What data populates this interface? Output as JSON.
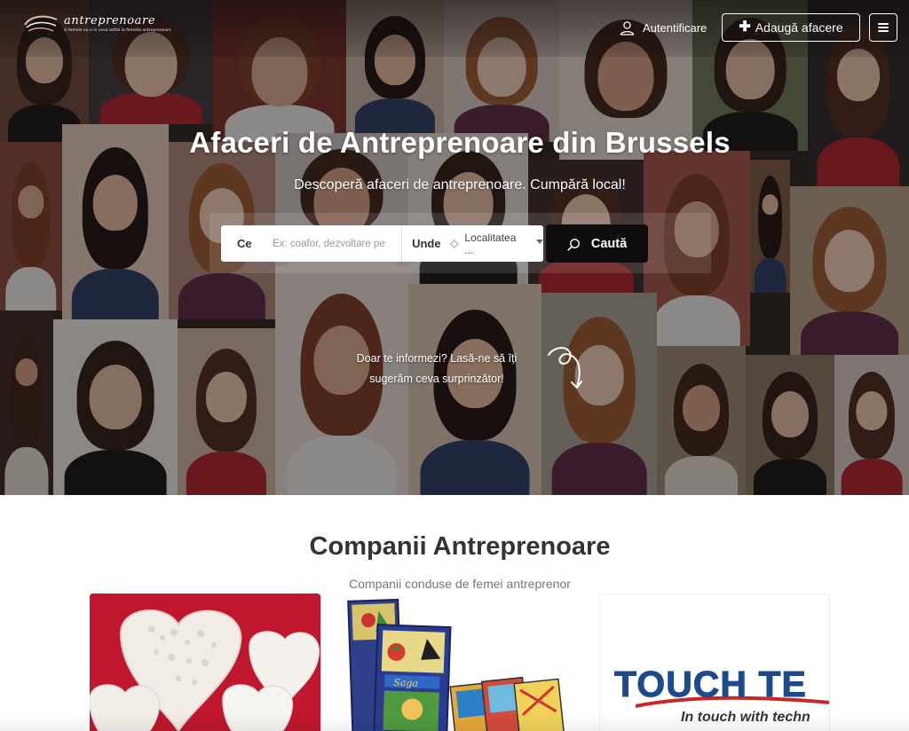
{
  "brand": {
    "name": "antreprenoare",
    "tagline": "O femeie nu e in ceva astfel la femeile antreprenoare"
  },
  "nav": {
    "login_label": "Autentificare",
    "add_business_label": "Adaugă afacere",
    "icons": {
      "login": "user-icon",
      "add": "plus-icon",
      "menu": "menu-icon"
    }
  },
  "hero": {
    "title": "Afaceri de Antreprenoare din Brussels",
    "subtitle": "Descoperă afaceri de antreprenoare. Cumpără local!",
    "hint_line1": "Doar te informezi? Lasă-ne să îți",
    "hint_line2": "sugerăm ceva surprinzător!"
  },
  "search": {
    "what_label": "Ce",
    "what_placeholder": "Ex: coafor, dezvoltare pe",
    "where_label": "Unde",
    "location_value": "Localitatea ...",
    "button_label": "Caută",
    "icons": {
      "location": "location-icon",
      "button": "search-icon"
    }
  },
  "section": {
    "title": "Companii Antreprenoare",
    "subtitle": "Companii conduse de femei antreprenor"
  },
  "cards": [
    {
      "image": "white-ceramic-hearts-on-red"
    },
    {
      "image": "tarot-card-deck"
    },
    {
      "image": "touch-tech-logo",
      "logo_text": "TOUCH TE",
      "tagline": "In touch with techn"
    }
  ],
  "colors": {
    "hero_overlay": "#140e0c",
    "button_dark": "#0d0d0d",
    "heading": "#333333",
    "subheading": "#777777",
    "touch_blue": "#1d4a8b",
    "card_red": "#c0162e"
  }
}
